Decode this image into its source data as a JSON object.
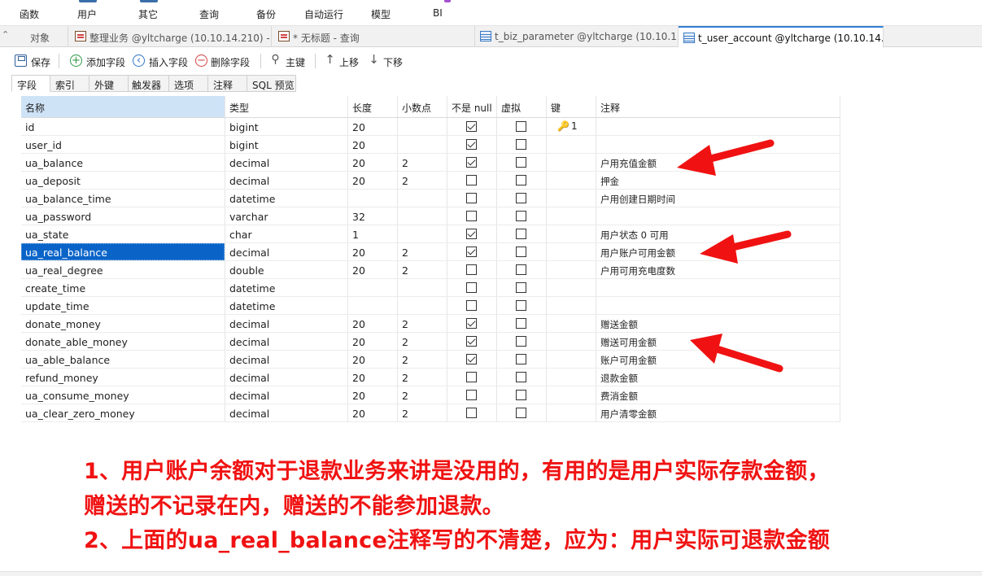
{
  "menu": {
    "items": [
      {
        "label": "函数"
      },
      {
        "label": "用户"
      },
      {
        "label": "其它"
      },
      {
        "label": "查询"
      },
      {
        "label": "备份"
      },
      {
        "label": "自动运行"
      },
      {
        "label": "模型"
      },
      {
        "label": "BI"
      }
    ]
  },
  "tabs": {
    "objects": "对象",
    "items": [
      {
        "label": "整理业务 @yltcharge (10.10.14.210) -...",
        "icon": "query-icon"
      },
      {
        "label": "* 无标题 - 查询",
        "icon": "query-icon"
      },
      {
        "label": "t_biz_parameter @yltcharge (10.10.1...",
        "icon": "table-icon"
      },
      {
        "label": "t_user_account @yltcharge (10.10.14....",
        "icon": "table-icon"
      }
    ]
  },
  "toolbar": {
    "save": "保存",
    "add_field": "添加字段",
    "insert_field": "插入字段",
    "delete_field": "删除字段",
    "primary_key": "主键",
    "move_up": "上移",
    "move_down": "下移"
  },
  "field_tabs": [
    "字段",
    "索引",
    "外键",
    "触发器",
    "选项",
    "注释",
    "SQL 预览"
  ],
  "grid": {
    "columns": [
      "名称",
      "类型",
      "长度",
      "小数点",
      "不是 null",
      "虚拟",
      "键",
      "注释"
    ],
    "rows": [
      {
        "name": "id",
        "type": "bigint",
        "length": "20",
        "decimals": "",
        "not_null": true,
        "virtual": false,
        "key": "1",
        "comment": ""
      },
      {
        "name": "user_id",
        "type": "bigint",
        "length": "20",
        "decimals": "",
        "not_null": true,
        "virtual": false,
        "key": "",
        "comment": ""
      },
      {
        "name": "ua_balance",
        "type": "decimal",
        "length": "20",
        "decimals": "2",
        "not_null": true,
        "virtual": false,
        "key": "",
        "comment": "户用充值金额"
      },
      {
        "name": "ua_deposit",
        "type": "decimal",
        "length": "20",
        "decimals": "2",
        "not_null": false,
        "virtual": false,
        "key": "",
        "comment": "押金"
      },
      {
        "name": "ua_balance_time",
        "type": "datetime",
        "length": "",
        "decimals": "",
        "not_null": false,
        "virtual": false,
        "key": "",
        "comment": "户用创建日期时间"
      },
      {
        "name": "ua_password",
        "type": "varchar",
        "length": "32",
        "decimals": "",
        "not_null": false,
        "virtual": false,
        "key": "",
        "comment": ""
      },
      {
        "name": "ua_state",
        "type": "char",
        "length": "1",
        "decimals": "",
        "not_null": true,
        "virtual": false,
        "key": "",
        "comment": "用户状态 0 可用"
      },
      {
        "name": "ua_real_balance",
        "type": "decimal",
        "length": "20",
        "decimals": "2",
        "not_null": true,
        "virtual": false,
        "key": "",
        "comment": "用户账户可用金额",
        "selected": true
      },
      {
        "name": "ua_real_degree",
        "type": "double",
        "length": "20",
        "decimals": "2",
        "not_null": false,
        "virtual": false,
        "key": "",
        "comment": "户用可用充电度数"
      },
      {
        "name": "create_time",
        "type": "datetime",
        "length": "",
        "decimals": "",
        "not_null": false,
        "virtual": false,
        "key": "",
        "comment": ""
      },
      {
        "name": "update_time",
        "type": "datetime",
        "length": "",
        "decimals": "",
        "not_null": false,
        "virtual": false,
        "key": "",
        "comment": ""
      },
      {
        "name": "donate_money",
        "type": "decimal",
        "length": "20",
        "decimals": "2",
        "not_null": true,
        "virtual": false,
        "key": "",
        "comment": "赠送金额"
      },
      {
        "name": "donate_able_money",
        "type": "decimal",
        "length": "20",
        "decimals": "2",
        "not_null": true,
        "virtual": false,
        "key": "",
        "comment": "赠送可用金额"
      },
      {
        "name": "ua_able_balance",
        "type": "decimal",
        "length": "20",
        "decimals": "2",
        "not_null": true,
        "virtual": false,
        "key": "",
        "comment": "账户可用金额"
      },
      {
        "name": "refund_money",
        "type": "decimal",
        "length": "20",
        "decimals": "2",
        "not_null": false,
        "virtual": false,
        "key": "",
        "comment": "退款金额"
      },
      {
        "name": "ua_consume_money",
        "type": "decimal",
        "length": "20",
        "decimals": "2",
        "not_null": false,
        "virtual": false,
        "key": "",
        "comment": "费消金额"
      },
      {
        "name": "ua_clear_zero_money",
        "type": "decimal",
        "length": "20",
        "decimals": "2",
        "not_null": false,
        "virtual": false,
        "key": "",
        "comment": "用户清零金额"
      }
    ]
  },
  "annotation": {
    "line1": "1、用户账户余额对于退款业务来讲是没用的，有用的是用户实际存款金额，",
    "line2": "赠送的不记录在内，赠送的不能参加退款。",
    "line3": "2、上面的ua_real_balance注释写的不清楚，应为：用户实际可退款金额",
    "color": "#f01212"
  }
}
